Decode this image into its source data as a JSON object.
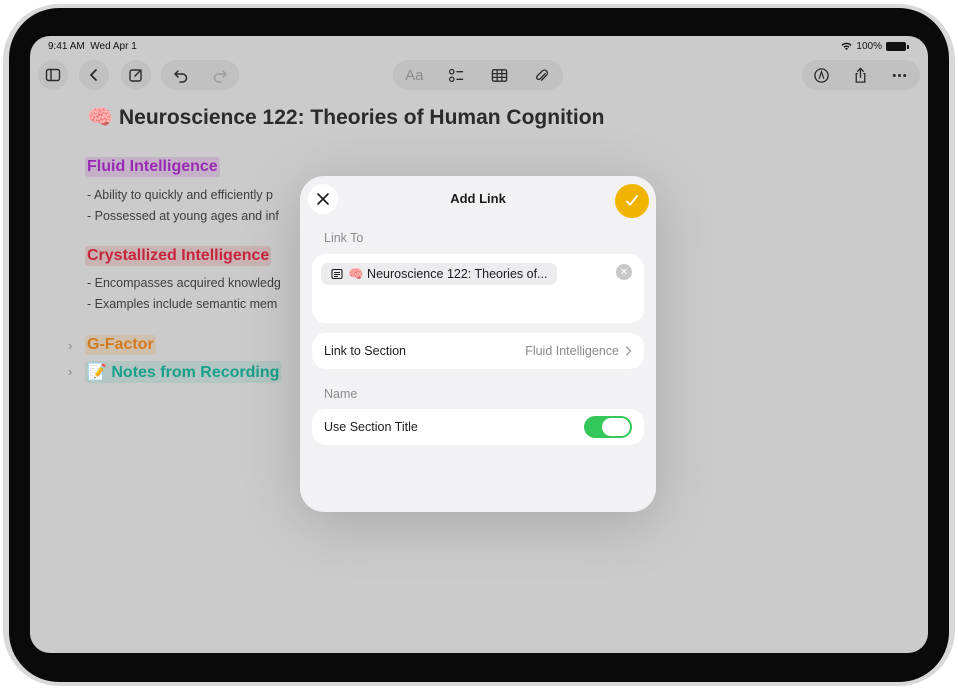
{
  "status": {
    "time": "9:41 AM",
    "date": "Wed Apr 1",
    "battery": "100%"
  },
  "toolbar": {
    "left": [
      "sidebar-icon",
      "back-icon",
      "compose-icon",
      "undo-icon",
      "redo-icon"
    ],
    "center": [
      "format-text",
      "checklist-icon",
      "table-icon",
      "attachment-icon"
    ],
    "format_label": "Aa",
    "right": [
      "markup-icon",
      "share-icon",
      "more-icon"
    ]
  },
  "note": {
    "title": "🧠 Neuroscience 122: Theories of Human Cognition",
    "sections": [
      {
        "heading": "Fluid Intelligence",
        "color": "#9a2ab5",
        "bullets": [
          "- Ability to quickly and efficiently p",
          "- Possessed at young ages and inf"
        ]
      },
      {
        "heading": "Crystallized Intelligence",
        "color": "#c6253c",
        "bullets": [
          "- Encompasses acquired knowledg",
          "- Examples include semantic mem"
        ]
      },
      {
        "heading": "G-Factor",
        "color": "#d37a1e",
        "collapsed": true
      },
      {
        "heading": "📝 Notes from Recording",
        "color": "#17a08a",
        "collapsed": true
      }
    ]
  },
  "modal": {
    "title": "Add Link",
    "link_to_label": "Link To",
    "link_chip": "🧠 Neuroscience 122: Theories of...",
    "link_section_label": "Link to Section",
    "link_section_value": "Fluid Intelligence",
    "name_label": "Name",
    "use_section_title_label": "Use Section Title",
    "use_section_title_on": true,
    "accent": "#f0b400"
  }
}
